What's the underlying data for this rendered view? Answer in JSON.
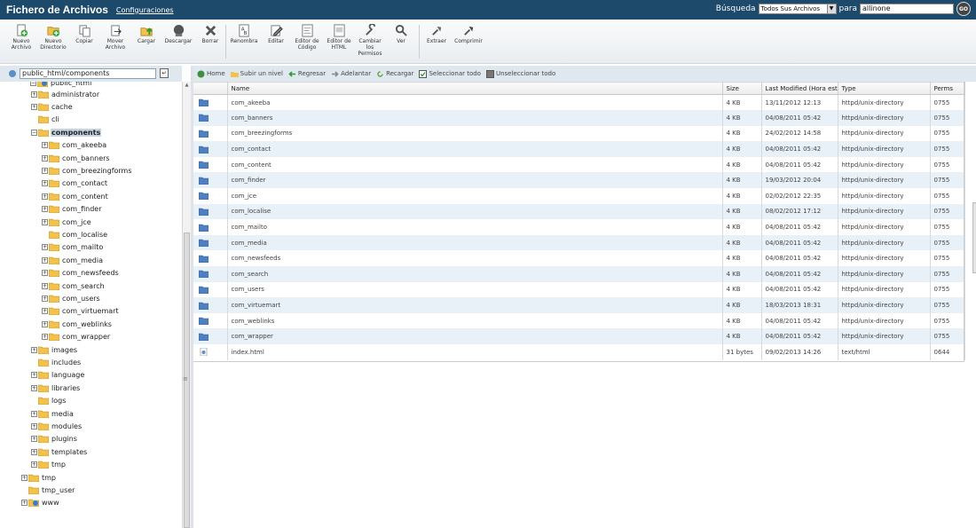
{
  "header": {
    "title": "Fichero de Archivos",
    "config_link": "Configuraciones",
    "search_label": "Búsqueda",
    "search_scope": "Todos Sus Archivos",
    "para_label": "para",
    "search_value": "allinone",
    "go_label": "GO"
  },
  "toolbar": {
    "items": [
      {
        "label": "Nuevo Archivo",
        "icon": "new-file-icon"
      },
      {
        "label": "Nuevo Directorio",
        "icon": "new-folder-icon"
      },
      {
        "label": "Copiar",
        "icon": "copy-icon"
      },
      {
        "label": "Mover Archivo",
        "icon": "move-icon"
      },
      {
        "label": "Cargar",
        "icon": "upload-icon"
      },
      {
        "label": "Descargar",
        "icon": "download-icon"
      },
      {
        "label": "Borrar",
        "icon": "delete-icon"
      },
      {
        "label": "Renombra",
        "icon": "rename-icon"
      },
      {
        "label": "Editar",
        "icon": "edit-icon"
      },
      {
        "label": "Editor de Código",
        "icon": "code-editor-icon"
      },
      {
        "label": "Editor de HTML",
        "icon": "html-editor-icon"
      },
      {
        "label": "Cambiar los Permisos",
        "icon": "permissions-icon"
      },
      {
        "label": "Ver",
        "icon": "view-icon"
      },
      {
        "label": "Extraer",
        "icon": "extract-icon"
      },
      {
        "label": "Comprimir",
        "icon": "compress-icon"
      }
    ]
  },
  "path": {
    "value": "public_html/components"
  },
  "actions": {
    "home": "Home",
    "up": "Subir un nivel",
    "back": "Regresar",
    "forward": "Adelantar",
    "reload": "Recargar",
    "select_all": "Seleccionar todo",
    "unselect_all": "Unseleccionar todo"
  },
  "tree": {
    "partial_top": "public_html",
    "items": [
      {
        "label": "administrator",
        "expandable": true
      },
      {
        "label": "cache",
        "expandable": true
      },
      {
        "label": "cli",
        "expandable": false
      },
      {
        "label": "components",
        "expandable": true,
        "selected": true
      },
      {
        "label": "com_akeeba",
        "expandable": true
      },
      {
        "label": "com_banners",
        "expandable": true
      },
      {
        "label": "com_breezingforms",
        "expandable": true
      },
      {
        "label": "com_contact",
        "expandable": true
      },
      {
        "label": "com_content",
        "expandable": true
      },
      {
        "label": "com_finder",
        "expandable": true
      },
      {
        "label": "com_jce",
        "expandable": true
      },
      {
        "label": "com_localise",
        "expandable": false
      },
      {
        "label": "com_mailto",
        "expandable": true
      },
      {
        "label": "com_media",
        "expandable": true
      },
      {
        "label": "com_newsfeeds",
        "expandable": true
      },
      {
        "label": "com_search",
        "expandable": true
      },
      {
        "label": "com_users",
        "expandable": true
      },
      {
        "label": "com_virtuemart",
        "expandable": true
      },
      {
        "label": "com_weblinks",
        "expandable": true
      },
      {
        "label": "com_wrapper",
        "expandable": true
      },
      {
        "label": "images",
        "expandable": true
      },
      {
        "label": "includes",
        "expandable": false
      },
      {
        "label": "language",
        "expandable": true
      },
      {
        "label": "libraries",
        "expandable": true
      },
      {
        "label": "logs",
        "expandable": false
      },
      {
        "label": "media",
        "expandable": true
      },
      {
        "label": "modules",
        "expandable": true
      },
      {
        "label": "plugins",
        "expandable": true
      },
      {
        "label": "templates",
        "expandable": true
      },
      {
        "label": "tmp",
        "expandable": true
      },
      {
        "label": "tmp",
        "expandable": true
      },
      {
        "label": "tmp_user",
        "expandable": false
      },
      {
        "label": "www",
        "expandable": true
      }
    ]
  },
  "table": {
    "headers": [
      "Name",
      "Size",
      "Last Modified (Hora está",
      "Type",
      "Perms"
    ],
    "rows": [
      {
        "name": "com_akeeba",
        "size": "4 KB",
        "modified": "13/11/2012 12:13",
        "type": "httpd/unix-directory",
        "perms": "0755",
        "kind": "folder"
      },
      {
        "name": "com_banners",
        "size": "4 KB",
        "modified": "04/08/2011 05:42",
        "type": "httpd/unix-directory",
        "perms": "0755",
        "kind": "folder"
      },
      {
        "name": "com_breezingforms",
        "size": "4 KB",
        "modified": "24/02/2012 14:58",
        "type": "httpd/unix-directory",
        "perms": "0755",
        "kind": "folder"
      },
      {
        "name": "com_contact",
        "size": "4 KB",
        "modified": "04/08/2011 05:42",
        "type": "httpd/unix-directory",
        "perms": "0755",
        "kind": "folder"
      },
      {
        "name": "com_content",
        "size": "4 KB",
        "modified": "04/08/2011 05:42",
        "type": "httpd/unix-directory",
        "perms": "0755",
        "kind": "folder"
      },
      {
        "name": "com_finder",
        "size": "4 KB",
        "modified": "19/03/2012 20:04",
        "type": "httpd/unix-directory",
        "perms": "0755",
        "kind": "folder"
      },
      {
        "name": "com_jce",
        "size": "4 KB",
        "modified": "02/02/2012 22:35",
        "type": "httpd/unix-directory",
        "perms": "0755",
        "kind": "folder"
      },
      {
        "name": "com_localise",
        "size": "4 KB",
        "modified": "08/02/2012 17:12",
        "type": "httpd/unix-directory",
        "perms": "0755",
        "kind": "folder"
      },
      {
        "name": "com_mailto",
        "size": "4 KB",
        "modified": "04/08/2011 05:42",
        "type": "httpd/unix-directory",
        "perms": "0755",
        "kind": "folder"
      },
      {
        "name": "com_media",
        "size": "4 KB",
        "modified": "04/08/2011 05:42",
        "type": "httpd/unix-directory",
        "perms": "0755",
        "kind": "folder"
      },
      {
        "name": "com_newsfeeds",
        "size": "4 KB",
        "modified": "04/08/2011 05:42",
        "type": "httpd/unix-directory",
        "perms": "0755",
        "kind": "folder"
      },
      {
        "name": "com_search",
        "size": "4 KB",
        "modified": "04/08/2011 05:42",
        "type": "httpd/unix-directory",
        "perms": "0755",
        "kind": "folder"
      },
      {
        "name": "com_users",
        "size": "4 KB",
        "modified": "04/08/2011 05:42",
        "type": "httpd/unix-directory",
        "perms": "0755",
        "kind": "folder"
      },
      {
        "name": "com_virtuemart",
        "size": "4 KB",
        "modified": "18/03/2013 18:31",
        "type": "httpd/unix-directory",
        "perms": "0755",
        "kind": "folder"
      },
      {
        "name": "com_weblinks",
        "size": "4 KB",
        "modified": "04/08/2011 05:42",
        "type": "httpd/unix-directory",
        "perms": "0755",
        "kind": "folder"
      },
      {
        "name": "com_wrapper",
        "size": "4 KB",
        "modified": "04/08/2011 05:42",
        "type": "httpd/unix-directory",
        "perms": "0755",
        "kind": "folder"
      },
      {
        "name": "index.html",
        "size": "31 bytes",
        "modified": "09/02/2013 14:26",
        "type": "text/html",
        "perms": "0644",
        "kind": "file"
      }
    ]
  },
  "colors": {
    "header_bg": "#1d4a6b",
    "panel_bar": "#dfe8ef",
    "row_alt": "#e8f0f8",
    "folder": "#f2c24d",
    "folder_blue": "#4f7fbf"
  }
}
